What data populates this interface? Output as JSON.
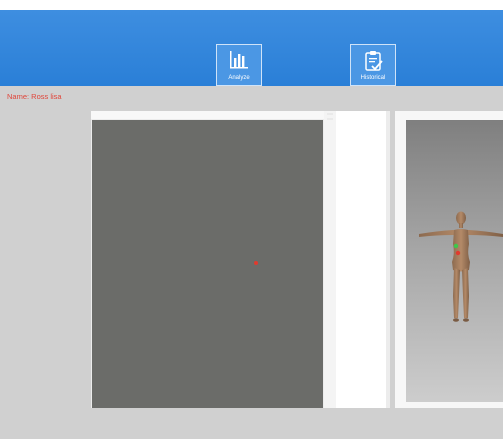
{
  "toolbar": {
    "analyze_label": "Analyze",
    "historical_label": "Historical"
  },
  "patient": {
    "name_line": "Name: Ross lisa"
  },
  "viewer": {
    "model": "3D human body model (female, T-pose)"
  },
  "colors": {
    "header_blue": "#2a7fd7",
    "name_text": "#e0453a",
    "marker_red": "#e03a2e",
    "marker_green": "#3cc84a"
  }
}
